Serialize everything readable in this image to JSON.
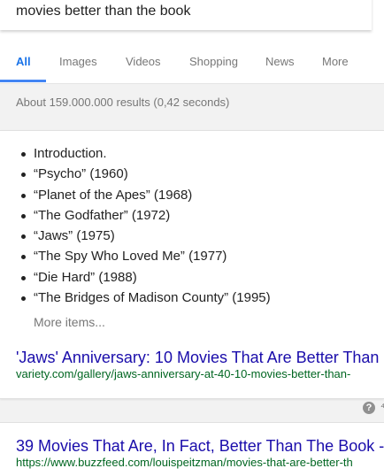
{
  "search": {
    "query": "movies better than the book"
  },
  "tabs": [
    {
      "label": "All",
      "active": true
    },
    {
      "label": "Images",
      "active": false
    },
    {
      "label": "Videos",
      "active": false
    },
    {
      "label": "Shopping",
      "active": false
    },
    {
      "label": "News",
      "active": false
    },
    {
      "label": "More",
      "active": false
    }
  ],
  "result_stats": "About 159.000.000 results (0,42 seconds)",
  "featured_snippet": {
    "items": [
      "Introduction.",
      "“Psycho” (1960)",
      "“Planet of the Apes” (1968)",
      "“The Godfather” (1972)",
      "“Jaws” (1975)",
      "“The Spy Who Loved Me” (1977)",
      "“Die Hard” (1988)",
      "“The Bridges of Madison County” (1995)"
    ],
    "more_items_label": "More items...",
    "title": "'Jaws' Anniversary: 10 Movies That Are Better Than",
    "url": "variety.com/gallery/jaws-anniversary-at-40-10-movies-better-than-"
  },
  "help": {
    "icon_glyph": "?",
    "trailing_glyph": "⁴"
  },
  "second_result": {
    "title": "39 Movies That Are, In Fact, Better Than The Book -",
    "url": "https://www.buzzfeed.com/louispeitzman/movies-that-are-better-th"
  },
  "colors": {
    "accent": "#4285f4",
    "link": "#1a0dab",
    "url": "#006621"
  }
}
